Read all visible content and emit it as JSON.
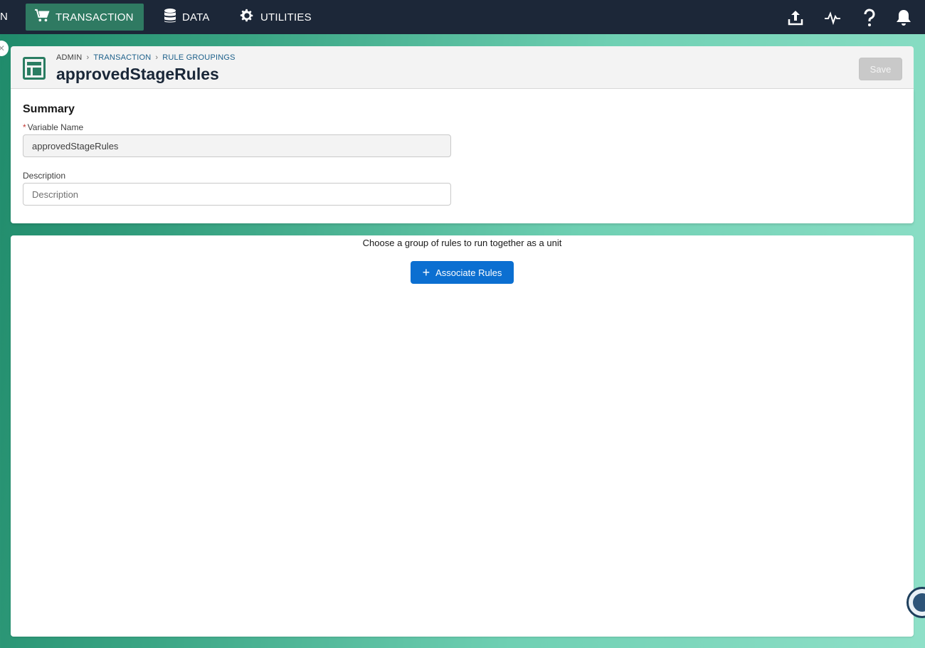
{
  "nav": {
    "cut_label": "N",
    "items": [
      {
        "label": "TRANSACTION",
        "icon": "cart-icon",
        "active": true
      },
      {
        "label": "DATA",
        "icon": "database-icon",
        "active": false
      },
      {
        "label": "UTILITIES",
        "icon": "gear-icon",
        "active": false
      }
    ],
    "right_icons": [
      "upload-icon",
      "activity-icon",
      "help-icon",
      "bell-icon"
    ]
  },
  "header": {
    "breadcrumb": [
      "ADMIN",
      "TRANSACTION",
      "RULE GROUPINGS"
    ],
    "title": "approvedStageRules",
    "save_label": "Save"
  },
  "summary": {
    "title": "Summary",
    "variable_name_label": "Variable Name",
    "variable_name_value": "approvedStageRules",
    "description_label": "Description",
    "description_placeholder": "Description"
  },
  "rules": {
    "hint": "Choose a group of rules to run together as a unit",
    "associate_label": "Associate Rules"
  },
  "colors": {
    "nav_bg": "#1c2738",
    "nav_active": "#2f7a62",
    "primary": "#0b6fd1",
    "brand": "#2a7d62"
  }
}
